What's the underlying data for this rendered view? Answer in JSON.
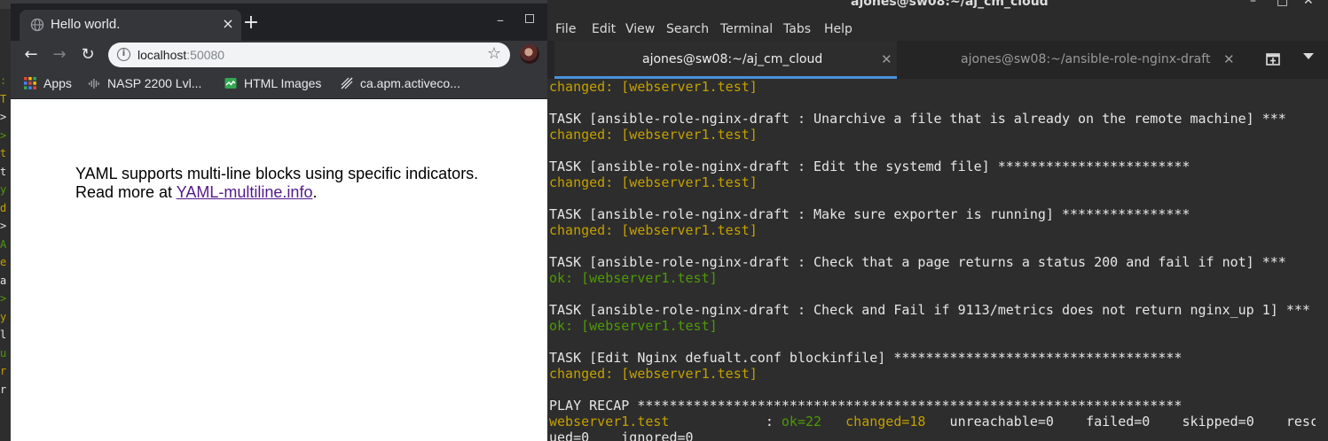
{
  "background_terminal": {
    "glyphs": [
      ":",
      "T",
      ">",
      ">",
      "t",
      "t",
      "y",
      "d",
      ">",
      "A",
      "e",
      "a",
      ">",
      "y",
      "l",
      "u",
      "r",
      "r"
    ]
  },
  "browser": {
    "tab_title": "Hello world.",
    "tab_close": "×",
    "new_tab": "+",
    "window_minimize": "–",
    "nav_back": "←",
    "nav_forward": "→",
    "nav_reload": "↻",
    "url_host": "localhost",
    "url_port": ":50080",
    "bookmarks": [
      {
        "label": "Apps",
        "icon": "apps-grid-icon"
      },
      {
        "label": "NASP 2200 Lvl...",
        "icon": "cisco-icon"
      },
      {
        "label": "HTML Images",
        "icon": "image-icon"
      },
      {
        "label": "ca.apm.activeco...",
        "icon": "bookmark-site-icon"
      }
    ],
    "page": {
      "line1": "YAML supports multi-line blocks using specific indicators.",
      "line2_prefix": "Read more at ",
      "link_text": "YAML-multiline.info",
      "line2_suffix": "."
    },
    "colors": {
      "link": "#551a8b",
      "tabbar": "#202124",
      "toolbar": "#35363a"
    }
  },
  "terminal": {
    "window_title": "ajones@sw08:~/aj_cm_cloud",
    "menu": [
      "File",
      "Edit",
      "View",
      "Search",
      "Terminal",
      "Tabs",
      "Help"
    ],
    "tabs": [
      {
        "label": "ajones@sw08:~/aj_cm_cloud",
        "active": true
      },
      {
        "label": "ajones@sw08:~/ansible-role-nginx-draft",
        "active": false
      }
    ],
    "colors": {
      "changed": "#c4a000",
      "ok": "#4e9a06",
      "text": "#e6e6e6",
      "active_tab_underline": "#4a90d9"
    },
    "lines": [
      [
        {
          "t": "changed: [webserver1.test]",
          "c": "yellow"
        }
      ],
      [
        {
          "t": "",
          "c": "white"
        }
      ],
      [
        {
          "t": "TASK [ansible-role-nginx-draft : Unarchive a file that is already on the remote machine] ***",
          "c": "white"
        }
      ],
      [
        {
          "t": "changed: [webserver1.test]",
          "c": "yellow"
        }
      ],
      [
        {
          "t": "",
          "c": "white"
        }
      ],
      [
        {
          "t": "TASK [ansible-role-nginx-draft : Edit the systemd file] ************************",
          "c": "white"
        }
      ],
      [
        {
          "t": "changed: [webserver1.test]",
          "c": "yellow"
        }
      ],
      [
        {
          "t": "",
          "c": "white"
        }
      ],
      [
        {
          "t": "TASK [ansible-role-nginx-draft : Make sure exporter is running] ****************",
          "c": "white"
        }
      ],
      [
        {
          "t": "changed: [webserver1.test]",
          "c": "yellow"
        }
      ],
      [
        {
          "t": "",
          "c": "white"
        }
      ],
      [
        {
          "t": "TASK [ansible-role-nginx-draft : Check that a page returns a status 200 and fail if not] ***",
          "c": "white"
        }
      ],
      [
        {
          "t": "ok: [webserver1.test]",
          "c": "green"
        }
      ],
      [
        {
          "t": "",
          "c": "white"
        }
      ],
      [
        {
          "t": "TASK [ansible-role-nginx-draft : Check and Fail if 9113/metrics does not return nginx_up 1] ***",
          "c": "white"
        }
      ],
      [
        {
          "t": "ok: [webserver1.test]",
          "c": "green"
        }
      ],
      [
        {
          "t": "",
          "c": "white"
        }
      ],
      [
        {
          "t": "TASK [Edit Nginx defualt.conf blockinfile] ************************************",
          "c": "white"
        }
      ],
      [
        {
          "t": "changed: [webserver1.test]",
          "c": "yellow"
        }
      ],
      [
        {
          "t": "",
          "c": "white"
        }
      ],
      [
        {
          "t": "PLAY RECAP ********************************************************************",
          "c": "white"
        }
      ],
      [
        {
          "t": "webserver1.test",
          "c": "yellow"
        },
        {
          "t": "            : ",
          "c": "white"
        },
        {
          "t": "ok=22",
          "c": "green"
        },
        {
          "t": "   ",
          "c": "white"
        },
        {
          "t": "changed=18",
          "c": "yellow"
        },
        {
          "t": "   unreachable=0    failed=0    skipped=0    resc",
          "c": "white"
        }
      ],
      [
        {
          "t": "ued=0    ignored=0",
          "c": "white"
        }
      ]
    ]
  }
}
